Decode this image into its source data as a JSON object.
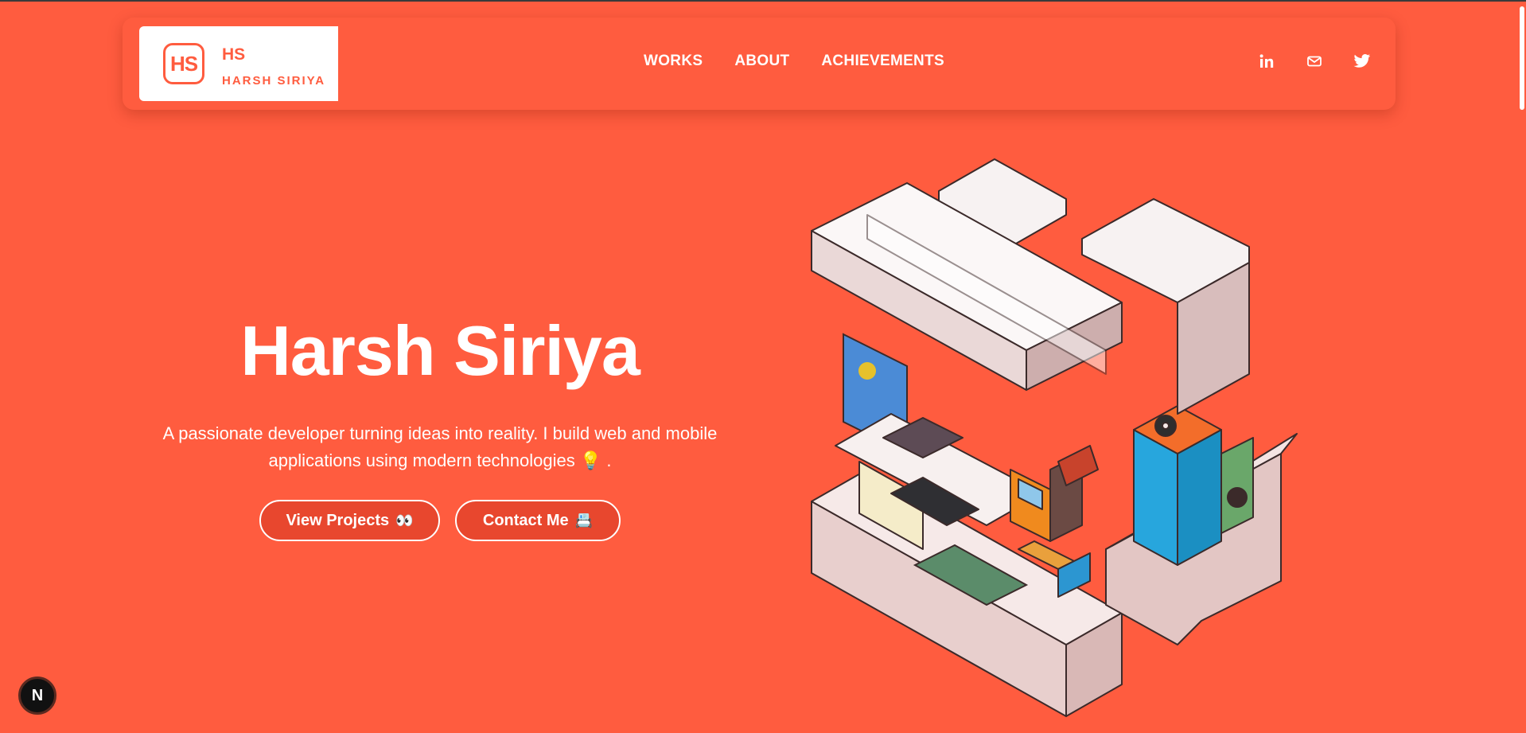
{
  "brand": {
    "logo_text": "HS",
    "short_name": "HS",
    "full_name": "HARSH SIRIYA"
  },
  "nav": {
    "links": [
      {
        "label": "WORKS"
      },
      {
        "label": "ABOUT"
      },
      {
        "label": "ACHIEVEMENTS"
      }
    ]
  },
  "socials": {
    "icons": [
      "linkedin-icon",
      "mail-icon",
      "twitter-icon"
    ]
  },
  "hero": {
    "title": "Harsh Siriya",
    "subtitle_line1": "A passionate developer turning ideas into reality. I build web and mobile",
    "subtitle_line2": "applications using modern technologies 💡 .",
    "primary_button": {
      "label": "View Projects",
      "emoji": "👀"
    },
    "secondary_button": {
      "label": "Contact Me",
      "emoji": "📇"
    }
  },
  "dev_badge": {
    "label": "N"
  },
  "colors": {
    "background": "#ff5c3f",
    "button_fill": "#e8472e",
    "text": "#ffffff",
    "brand_box": "#ffffff"
  }
}
